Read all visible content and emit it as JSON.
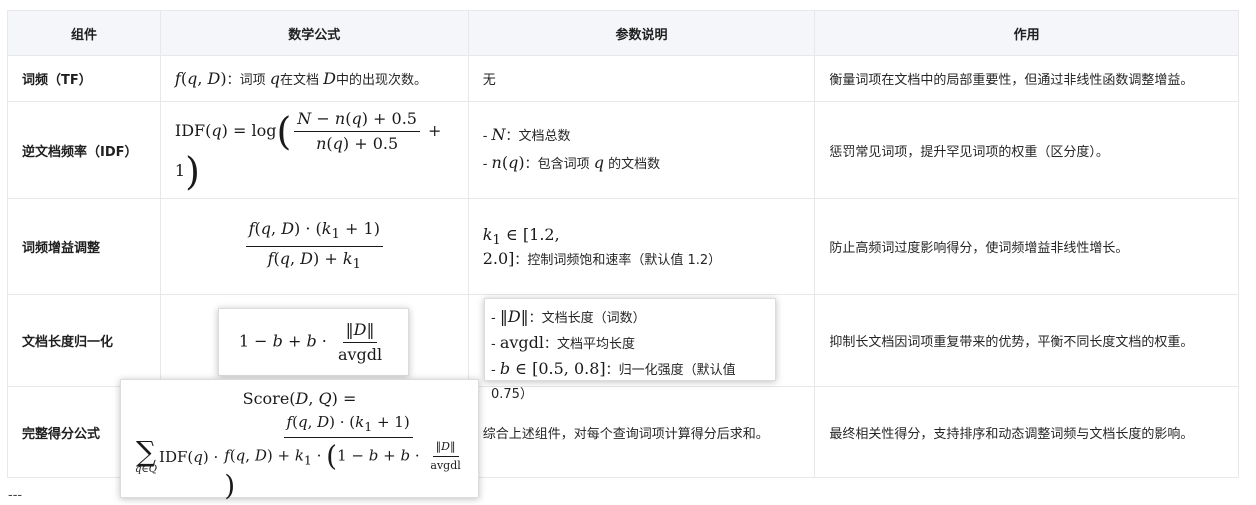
{
  "table": {
    "headers": [
      "组件",
      "数学公式",
      "参数说明",
      "作用"
    ],
    "rows": [
      {
        "component": "词频（TF）",
        "formula_text": "：词项",
        "formula_text2": "在文档",
        "formula_text3": "中的出现次数。",
        "params": "无",
        "role": "衡量词项在文档中的局部重要性，但通过非线性函数调整增益。"
      },
      {
        "component": "逆文档频率（IDF）",
        "params": [
          "：文档总数",
          "：包含词项",
          "的文档数"
        ],
        "role": "惩罚常见词项，提升罕见词项的权重（区分度）。"
      },
      {
        "component": "词频增益调整",
        "params": "：控制词频饱和速率（默认值 1.2）",
        "role": "防止高频词过度影响得分，使词频增益非线性增长。"
      },
      {
        "component": "文档长度归一化",
        "params": [
          "：文档长度（词数）",
          "：文档平均长度",
          "：归一化强度（默认值 0.75）"
        ],
        "role": "抑制长文档因词项重复带来的优势，平衡不同长度文档的权重。"
      },
      {
        "component": "完整得分公式",
        "params": "综合上述组件，对每个查询词项计算得分后求和。",
        "role": "最终相关性得分，支持排序和动态调整词频与文档长度的影响。"
      }
    ]
  },
  "footer": {
    "separator": "---"
  }
}
